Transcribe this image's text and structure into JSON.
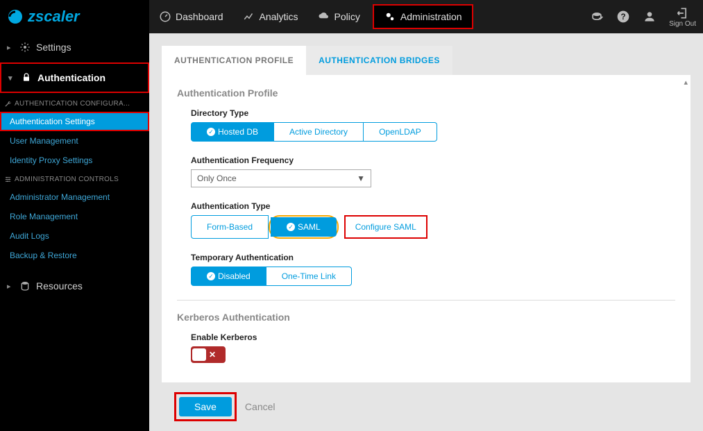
{
  "brand": "zscaler",
  "topnav": {
    "items": [
      {
        "label": "Dashboard",
        "icon": "gauge"
      },
      {
        "label": "Analytics",
        "icon": "chart"
      },
      {
        "label": "Policy",
        "icon": "cloud"
      },
      {
        "label": "Administration",
        "icon": "gears",
        "active": true
      }
    ],
    "signout": "Sign Out"
  },
  "sidebar": {
    "settings": "Settings",
    "authentication": "Authentication",
    "auth_config_header": "AUTHENTICATION CONFIGURA...",
    "auth_items": [
      "Authentication Settings",
      "User Management",
      "Identity Proxy Settings"
    ],
    "admin_controls_header": "ADMINISTRATION CONTROLS",
    "admin_items": [
      "Administrator Management",
      "Role Management",
      "Audit Logs",
      "Backup & Restore"
    ],
    "resources": "Resources"
  },
  "tabs": {
    "profile": "AUTHENTICATION PROFILE",
    "bridges": "AUTHENTICATION BRIDGES"
  },
  "profile": {
    "title": "Authentication Profile",
    "directory_type": {
      "label": "Directory Type",
      "options": [
        "Hosted DB",
        "Active Directory",
        "OpenLDAP"
      ],
      "selected": "Hosted DB"
    },
    "auth_frequency": {
      "label": "Authentication Frequency",
      "value": "Only Once"
    },
    "auth_type": {
      "label": "Authentication Type",
      "options": [
        "Form-Based",
        "SAML"
      ],
      "selected": "SAML",
      "configure_link": "Configure SAML"
    },
    "temp_auth": {
      "label": "Temporary Authentication",
      "options": [
        "Disabled",
        "One-Time Link"
      ],
      "selected": "Disabled"
    },
    "kerberos": {
      "title": "Kerberos Authentication",
      "label": "Enable Kerberos",
      "enabled": false
    }
  },
  "footer": {
    "save": "Save",
    "cancel": "Cancel"
  }
}
